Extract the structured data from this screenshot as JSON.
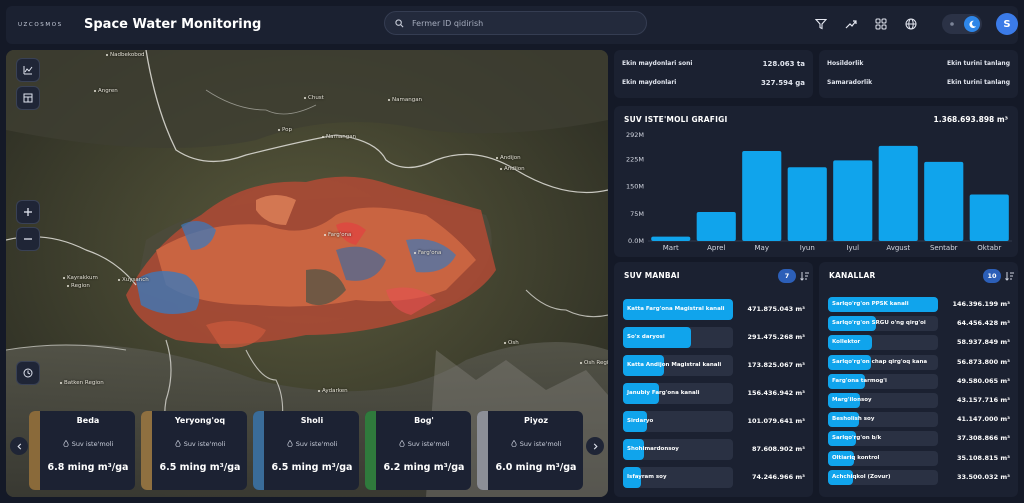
{
  "header": {
    "logo_text": "UZCOSMOS",
    "title": "Space Water Monitoring",
    "search_placeholder": "Fermer ID qidirish",
    "avatar_initial": "S"
  },
  "stats_left": [
    {
      "label": "Ekin maydonlari soni",
      "value": "128.063 ta"
    },
    {
      "label": "Ekin maydonlari",
      "value": "327.594 ga"
    }
  ],
  "stats_right": [
    {
      "label": "Hosildorlik",
      "value": "Ekin turini tanlang"
    },
    {
      "label": "Samaradorlik",
      "value": "Ekin turini tanlang"
    }
  ],
  "chart": {
    "title": "SUV ISTE'MOLI GRAFIGI",
    "total": "1.368.693.898 m³"
  },
  "chart_data": {
    "type": "bar",
    "categories": [
      "Mart",
      "Aprel",
      "May",
      "Iyun",
      "Iyul",
      "Avgust",
      "Sentabr",
      "Oktabr"
    ],
    "values": [
      12,
      80,
      248,
      203,
      222,
      262,
      218,
      128
    ],
    "ylim": [
      0,
      292
    ],
    "yticks": [
      "0.0M",
      "75M",
      "150M",
      "225M",
      "292M"
    ],
    "ytick_values": [
      0,
      75,
      150,
      225,
      292
    ],
    "color": "#10a4ec"
  },
  "suv_manbai": {
    "title": "SUV MANBAI",
    "count": "7",
    "items": [
      {
        "label": "Katta Farg'ona Magistral kanali",
        "value": "471.875.043 m³",
        "fill": 1.0
      },
      {
        "label": "So'x daryosi",
        "value": "291.475.268 m³",
        "fill": 0.62
      },
      {
        "label": "Katta Andijon Magistral kanali",
        "value": "173.825.067 m³",
        "fill": 0.37
      },
      {
        "label": "Janubiy Farg'ona kanali",
        "value": "156.436.942 m³",
        "fill": 0.33
      },
      {
        "label": "Sirdaryo",
        "value": "101.079.641 m³",
        "fill": 0.22
      },
      {
        "label": "Shohimardonsoy",
        "value": "87.608.902 m³",
        "fill": 0.19
      },
      {
        "label": "Isfayram soy",
        "value": "74.246.966 m³",
        "fill": 0.16
      }
    ]
  },
  "kanallar": {
    "title": "KANALLAR",
    "count": "10",
    "items": [
      {
        "label": "Sarlqo'rg'on PPSK kanali",
        "value": "146.396.199 m³",
        "fill": 1.0
      },
      {
        "label": "Sarlqo'rg'on SRGU o'ng qirg'oi",
        "value": "64.456.428 m³",
        "fill": 0.44
      },
      {
        "label": "Kollektor",
        "value": "58.937.849 m³",
        "fill": 0.4
      },
      {
        "label": "Sarlqo'rg'on chap qirg'oq kana",
        "value": "56.873.800 m³",
        "fill": 0.39
      },
      {
        "label": "Farg'ona tarmog'i",
        "value": "49.580.065 m³",
        "fill": 0.34
      },
      {
        "label": "Marg'ilonsoy",
        "value": "43.157.716 m³",
        "fill": 0.29
      },
      {
        "label": "Besholish soy",
        "value": "41.147.000 m³",
        "fill": 0.28
      },
      {
        "label": "Sarlqo'rg'on b/k",
        "value": "37.308.866 m³",
        "fill": 0.25
      },
      {
        "label": "Oltiariq kontrol",
        "value": "35.108.815 m³",
        "fill": 0.24
      },
      {
        "label": "Achchiqkol (Zovur)",
        "value": "33.500.032 m³",
        "fill": 0.23
      }
    ]
  },
  "crops": [
    {
      "name": "Beda",
      "metric": "Suv iste'moli",
      "value": "6.8 ming m³/ga",
      "color": "#8a6a3a"
    },
    {
      "name": "Yeryong'oq",
      "metric": "Suv iste'moli",
      "value": "6.5 ming m³/ga",
      "color": "#8f7040"
    },
    {
      "name": "Sholi",
      "metric": "Suv iste'moli",
      "value": "6.5 ming m³/ga",
      "color": "#3a6c99"
    },
    {
      "name": "Bog'",
      "metric": "Suv iste'moli",
      "value": "6.2 ming m³/ga",
      "color": "#2f7a3c"
    },
    {
      "name": "Piyoz",
      "metric": "Suv iste'moli",
      "value": "6.0 ming m³/ga",
      "color": "#8c8f97"
    }
  ],
  "map_labels": [
    {
      "text": "Nadbekobod",
      "x": 100,
      "y": 2
    },
    {
      "text": "Angren",
      "x": 88,
      "y": 38
    },
    {
      "text": "Chust",
      "x": 298,
      "y": 45
    },
    {
      "text": "Namangan",
      "x": 382,
      "y": 47
    },
    {
      "text": "Pop",
      "x": 272,
      "y": 77
    },
    {
      "text": "Namangan",
      "x": 316,
      "y": 84
    },
    {
      "text": "Andijon",
      "x": 490,
      "y": 105
    },
    {
      "text": "Andijon",
      "x": 494,
      "y": 116
    },
    {
      "text": "Farg'ona",
      "x": 318,
      "y": 182
    },
    {
      "text": "Farg'ona",
      "x": 408,
      "y": 200
    },
    {
      "text": "Xuysanch",
      "x": 112,
      "y": 227
    },
    {
      "text": "Kayrakkum",
      "x": 57,
      "y": 225
    },
    {
      "text": "Region",
      "x": 61,
      "y": 233
    },
    {
      "text": "Osh",
      "x": 498,
      "y": 290
    },
    {
      "text": "Osh Region",
      "x": 574,
      "y": 310
    },
    {
      "text": "Aydarken",
      "x": 312,
      "y": 338
    },
    {
      "text": "Batken Region",
      "x": 54,
      "y": 330
    }
  ]
}
